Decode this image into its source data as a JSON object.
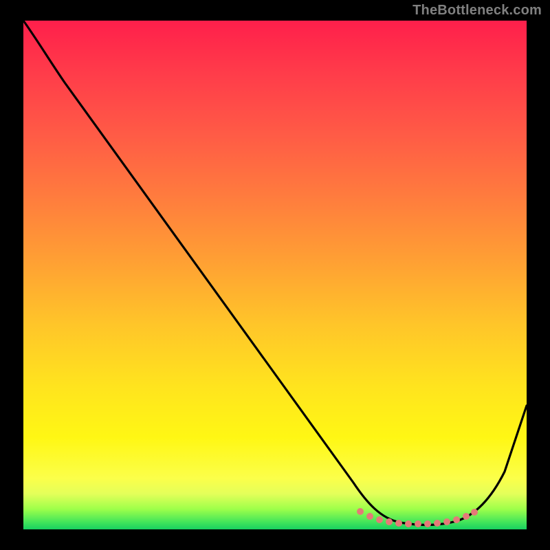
{
  "watermark": "TheBottleneck.com",
  "chart_data": {
    "type": "line",
    "title": "",
    "xlabel": "",
    "ylabel": "",
    "xlim": [
      0,
      100
    ],
    "ylim": [
      0,
      100
    ],
    "series": [
      {
        "name": "black-curve",
        "x": [
          0,
          4,
          10,
          20,
          30,
          40,
          50,
          60,
          66,
          70,
          74,
          78,
          82,
          86,
          90,
          94,
          100
        ],
        "y": [
          100,
          96,
          89,
          75,
          61,
          47,
          33,
          19,
          9,
          4,
          1.5,
          0.7,
          0.5,
          0.6,
          2,
          7,
          24
        ]
      },
      {
        "name": "pink-trough-band",
        "x": [
          66,
          70,
          74,
          78,
          82,
          86,
          89
        ],
        "y": [
          3.0,
          1.6,
          1.0,
          0.8,
          0.8,
          1.2,
          2.4
        ]
      }
    ],
    "colors": {
      "curve": "#000000",
      "trough_band": "#e47a78",
      "background_top": "#ff1f4b",
      "background_bottom": "#18d060",
      "frame": "#000000"
    }
  }
}
